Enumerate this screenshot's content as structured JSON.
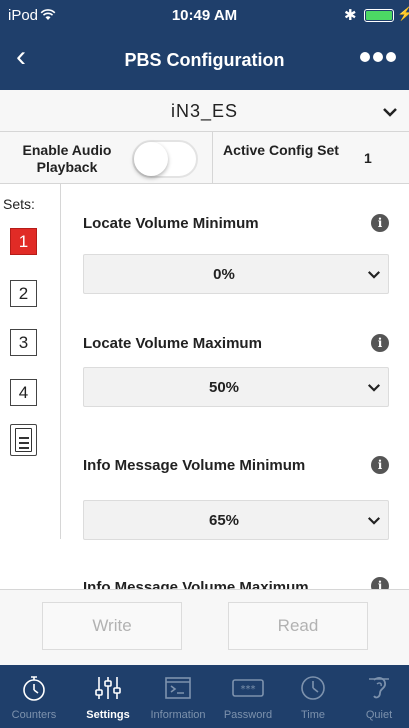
{
  "status_bar": {
    "carrier": "iPod",
    "time": "10:49 AM",
    "bluetooth": "✱",
    "charging": "⚡"
  },
  "nav": {
    "back_icon": "‹",
    "title": "PBS Configuration"
  },
  "device": {
    "name": "iN3_ES",
    "chevron": "⌄"
  },
  "config": {
    "audio_label": "Enable Audio Playback",
    "audio_enabled": false,
    "active_label": "Active Config Set",
    "active_value": "1"
  },
  "sets": {
    "label": "Sets:",
    "items": [
      "1",
      "2",
      "3",
      "4"
    ],
    "active": "1"
  },
  "settings": [
    {
      "label": "Locate Volume Minimum",
      "value": "0%"
    },
    {
      "label": "Locate Volume Maximum",
      "value": "50%"
    },
    {
      "label": "Info Message Volume Minimum",
      "value": "65%"
    },
    {
      "label": "Info Message Volume Maximum",
      "value": ""
    }
  ],
  "info_glyph": "i",
  "chevron_glyph": "⌄",
  "actions": {
    "write": "Write",
    "read": "Read"
  },
  "tabs": [
    {
      "label": "Counters",
      "icon": "stopwatch-icon"
    },
    {
      "label": "Settings",
      "icon": "sliders-icon",
      "active": true
    },
    {
      "label": "Information",
      "icon": "terminal-icon"
    },
    {
      "label": "Password",
      "icon": "password-icon"
    },
    {
      "label": "Time",
      "icon": "clock-icon"
    },
    {
      "label": "Quiet",
      "icon": "quiet-icon"
    }
  ],
  "colors": {
    "nav": "#1f3f6b",
    "active_set": "#e12b26",
    "inactive_tab": "#7d92ad"
  }
}
